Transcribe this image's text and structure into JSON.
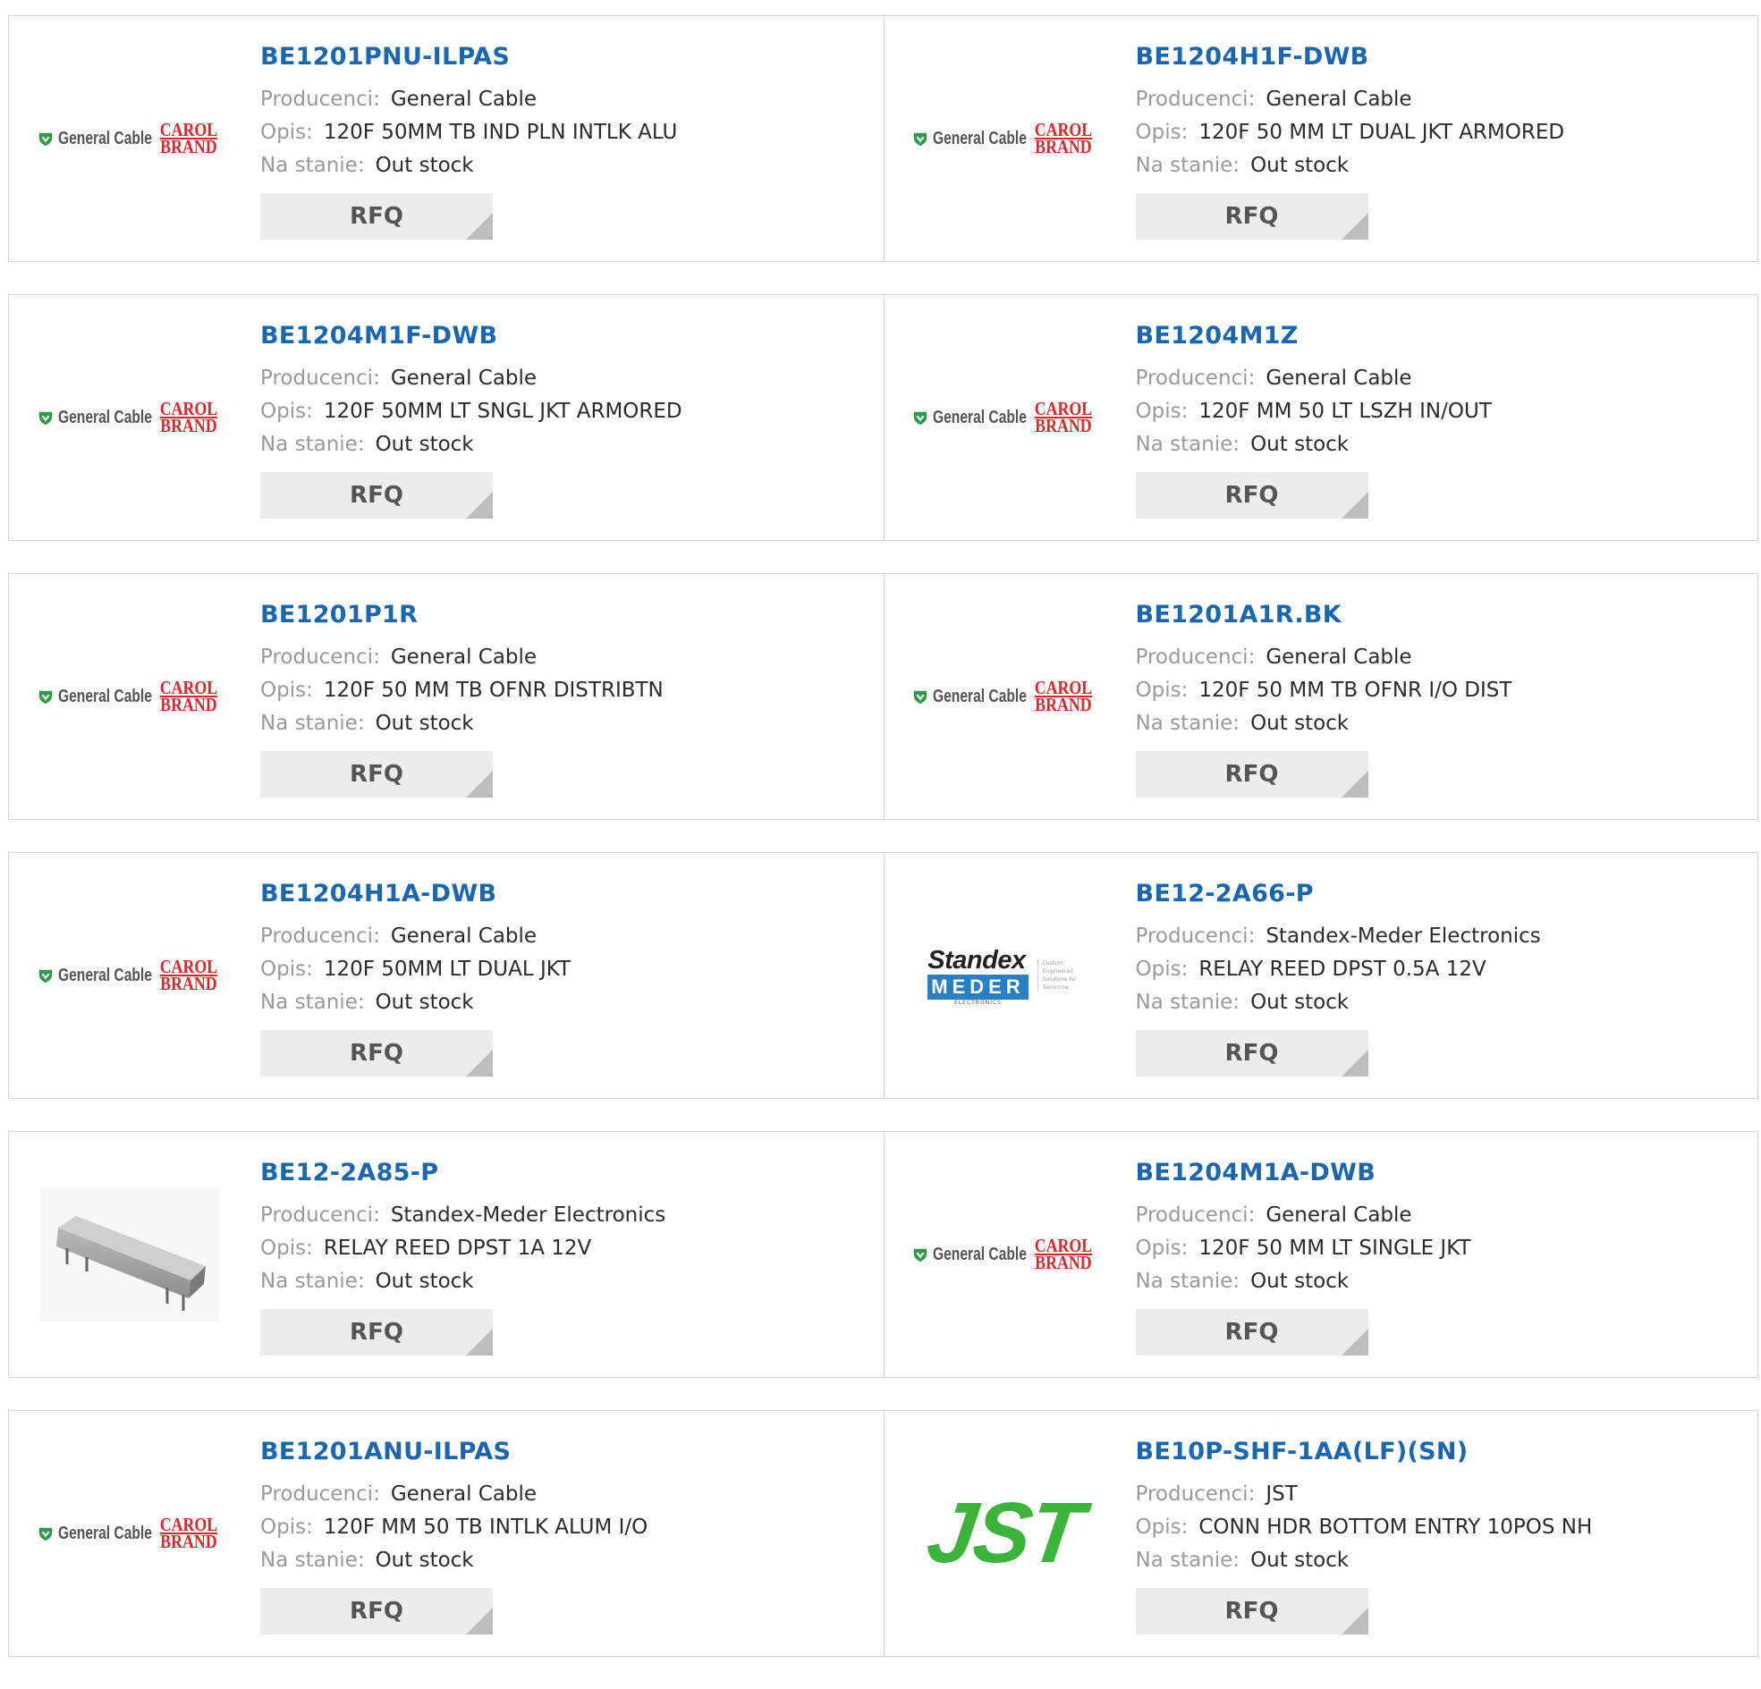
{
  "labels": {
    "manufacturer": "Producenci:",
    "description": "Opis:",
    "stock": "Na stanie:",
    "rfq": "RFQ"
  },
  "logos": {
    "general_cable": {
      "text": "General Cable",
      "carol_line1": "CAROL",
      "carol_line2": "BRAND",
      "color_shield": "#2e9a4a",
      "color_carol": "#e32428"
    },
    "standex_meder": {
      "line1": "Standex",
      "line2": "MEDER",
      "line3": "ELECTRONICS",
      "tagline": "Custom Engineered Solutions for Tomorrow",
      "color_band": "#2a7fc4"
    },
    "jst": {
      "text": "JST",
      "color": "#3cb43c"
    }
  },
  "products": [
    {
      "part": "BE1201PNU-ILPAS",
      "manufacturer": "General Cable",
      "description": "120F 50MM TB IND PLN INTLK ALU",
      "stock": "Out stock",
      "logo": "general-cable"
    },
    {
      "part": "BE1204H1F-DWB",
      "manufacturer": "General Cable",
      "description": "120F 50 MM LT DUAL JKT ARMORED",
      "stock": "Out stock",
      "logo": "general-cable"
    },
    {
      "part": "BE1204M1F-DWB",
      "manufacturer": "General Cable",
      "description": "120F 50MM LT SNGL JKT ARMORED",
      "stock": "Out stock",
      "logo": "general-cable"
    },
    {
      "part": "BE1204M1Z",
      "manufacturer": "General Cable",
      "description": "120F MM 50 LT LSZH IN/OUT",
      "stock": "Out stock",
      "logo": "general-cable"
    },
    {
      "part": "BE1201P1R",
      "manufacturer": "General Cable",
      "description": "120F 50 MM TB OFNR DISTRIBTN",
      "stock": "Out stock",
      "logo": "general-cable"
    },
    {
      "part": "BE1201A1R.BK",
      "manufacturer": "General Cable",
      "description": "120F 50 MM TB OFNR I/O DIST",
      "stock": "Out stock",
      "logo": "general-cable"
    },
    {
      "part": "BE1204H1A-DWB",
      "manufacturer": "General Cable",
      "description": "120F 50MM LT DUAL JKT",
      "stock": "Out stock",
      "logo": "general-cable"
    },
    {
      "part": "BE12-2A66-P",
      "manufacturer": "Standex-Meder Electronics",
      "description": "RELAY REED DPST 0.5A 12V",
      "stock": "Out stock",
      "logo": "standex-meder"
    },
    {
      "part": "BE12-2A85-P",
      "manufacturer": "Standex-Meder Electronics",
      "description": "RELAY REED DPST 1A 12V",
      "stock": "Out stock",
      "logo": "relay-photo"
    },
    {
      "part": "BE1204M1A-DWB",
      "manufacturer": "General Cable",
      "description": "120F 50 MM LT SINGLE JKT",
      "stock": "Out stock",
      "logo": "general-cable"
    },
    {
      "part": "BE1201ANU-ILPAS",
      "manufacturer": "General Cable",
      "description": "120F MM 50 TB INTLK ALUM I/O",
      "stock": "Out stock",
      "logo": "general-cable"
    },
    {
      "part": "BE10P-SHF-1AA(LF)(SN)",
      "manufacturer": "JST",
      "description": "CONN HDR BOTTOM ENTRY 10POS NH",
      "stock": "Out stock",
      "logo": "jst"
    }
  ]
}
